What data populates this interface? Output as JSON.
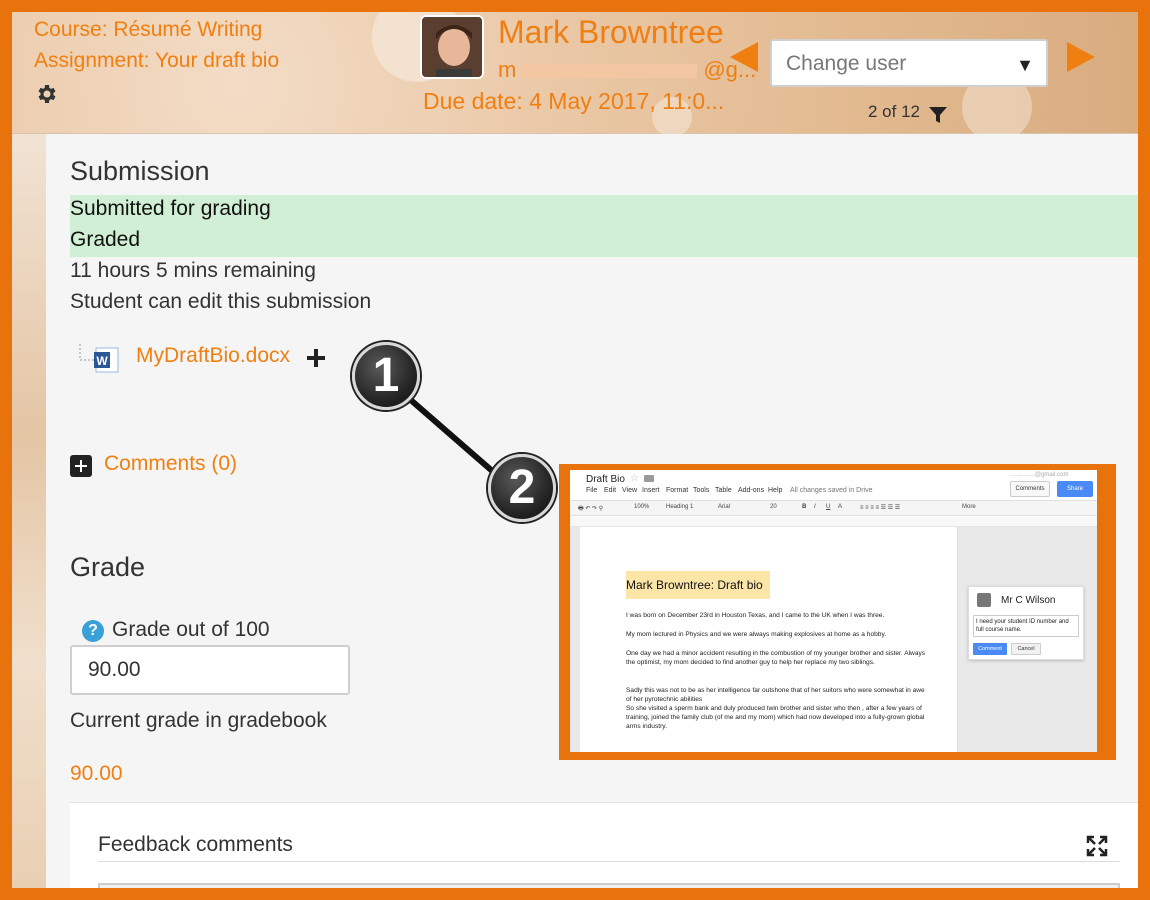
{
  "header": {
    "course": "Course: Résumé Writing",
    "assignment": "Assignment: Your draft bio",
    "user_name": "Mark Browntree",
    "email_start": "m",
    "email_end": "@g...",
    "due_date": "Due date: 4 May 2017, 11:0...",
    "change_user_placeholder": "Change user",
    "pager": "2 of 12"
  },
  "submission": {
    "title": "Submission",
    "status_submitted": "Submitted for grading",
    "status_graded": "Graded",
    "time_remaining": "11 hours 5 mins remaining",
    "edit_note": "Student can edit this submission",
    "file_name": "MyDraftBio.docx",
    "comments_link": "Comments (0)"
  },
  "grade": {
    "title": "Grade",
    "grade_label": "Grade out of 100",
    "grade_value": "90.00",
    "gradebook_label": "Current grade in gradebook",
    "gradebook_value": "90.00",
    "feedback_label": "Feedback comments"
  },
  "callouts": {
    "one": "1",
    "two": "2"
  },
  "inset": {
    "doc_title": "Draft Bio",
    "menu": [
      "File",
      "Edit",
      "View",
      "Insert",
      "Format",
      "Tools",
      "Table",
      "Add-ons",
      "Help"
    ],
    "saved_status": "All changes saved in Drive",
    "account_email": "...............@gmail.com",
    "comments_btn": "Comments",
    "share_btn": "Share",
    "toolbar": [
      "100%",
      "Heading 1",
      "Arial",
      "20",
      "B",
      "I",
      "U",
      "A",
      "More"
    ],
    "heading": "Mark Browntree: Draft bio",
    "paragraphs": [
      "I was born on December 23rd in Houston Texas, and I came to the UK when I was three.",
      "My mom lectured in Physics and we were always making explosives at home as a hobby.",
      "One day we had a minor accident resulting in the combustion of my younger brother and sister. Always the optimist, my mom decided to find another guy to help her replace my two siblings.",
      "Sadly this was not to be as her intelligence far outshone that of her suitors who were somewhat in awe of her pyrotechnic abilities",
      "So she visited a sperm bank and duly produced twin brother and sister who then , after a few years of training, joined the family club (of me and my mom) which had now developed into a fully-grown global arms industry."
    ],
    "comment_author": "Mr C Wilson",
    "comment_text": "I need your student ID number and full course name.",
    "comment_btn": "Comment",
    "cancel_btn": "Cancel"
  },
  "colors": {
    "accent": "#f07f12",
    "frame": "#e8730c",
    "status_band": "#d1efd4"
  },
  "icons": [
    "gear-icon",
    "prev-arrow-icon",
    "next-arrow-icon",
    "chevron-down-icon",
    "filter-icon",
    "word-file-icon",
    "plus-icon",
    "expand-icon",
    "help-icon",
    "fullscreen-icon"
  ]
}
